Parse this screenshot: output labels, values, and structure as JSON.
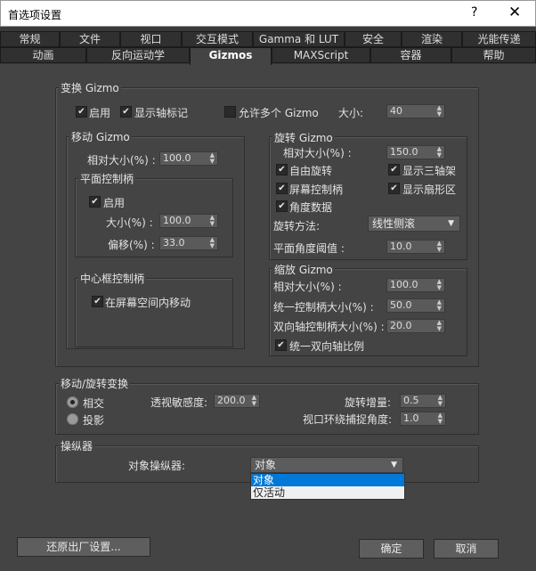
{
  "window": {
    "title": "首选项设置",
    "help": "?",
    "close": "✕"
  },
  "tabs_row1": [
    "常规",
    "文件",
    "视口",
    "交互模式",
    "Gamma 和 LUT",
    "安全",
    "渲染",
    "光能传递"
  ],
  "tabs_row2": [
    "动画",
    "反向运动学",
    "Gizmos",
    "MAXScript",
    "容器",
    "帮助"
  ],
  "transform_gizmo": {
    "title": "变换 Gizmo",
    "enable": "启用",
    "show_axis_labels": "显示轴标记",
    "allow_multiple": "允许多个 Gizmo",
    "size_label": "大小:",
    "size_value": "40"
  },
  "move_gizmo": {
    "title": "移动 Gizmo",
    "relative_size_label": "相对大小(%) :",
    "relative_size_value": "100.0",
    "plane_handles": {
      "title": "平面控制柄",
      "enable": "启用",
      "size_label": "大小(%) :",
      "size_value": "100.0",
      "offset_label": "偏移(%) :",
      "offset_value": "33.0"
    },
    "center_box": {
      "title": "中心框控制柄",
      "move_in_screen_space": "在屏幕空间内移动"
    }
  },
  "rotate_gizmo": {
    "title": "旋转 Gizmo",
    "relative_size_label": "相对大小(%) :",
    "relative_size_value": "150.0",
    "free_rotate": "自由旋转",
    "show_tri_axis": "显示三轴架",
    "screen_handle": "屏幕控制柄",
    "show_sector": "显示扇形区",
    "angle_data": "角度数据",
    "method_label": "旋转方法:",
    "method_value": "线性侧滚",
    "plane_threshold_label": "平面角度阈值 :",
    "plane_threshold_value": "10.0"
  },
  "scale_gizmo": {
    "title": "缩放 Gizmo",
    "relative_size_label": "相对大小(%) :",
    "relative_size_value": "100.0",
    "uniform_label": "统一控制柄大小(%) :",
    "uniform_value": "50.0",
    "biaxial_label": "双向轴控制柄大小(%) :",
    "biaxial_value": "20.0",
    "uniform_biaxial_scale": "统一双向轴比例"
  },
  "move_rotate_transform": {
    "title": "移动/旋转变换",
    "perspective": "相交",
    "projection": "投影",
    "perspective_sensitivity_label": "透视敏感度:",
    "perspective_sensitivity_value": "200.0",
    "rotate_increment_label": "旋转增量:",
    "rotate_increment_value": "0.5",
    "viewport_orbit_label": "视口环绕捕捉角度:",
    "viewport_orbit_value": "1.0"
  },
  "manipulators": {
    "title": "操纵器",
    "object_manip_label": "对象操纵器:",
    "selected": "对象",
    "options": [
      "对象",
      "仅活动"
    ]
  },
  "footer": {
    "reset": "还原出厂设置...",
    "ok": "确定",
    "cancel": "取消"
  }
}
